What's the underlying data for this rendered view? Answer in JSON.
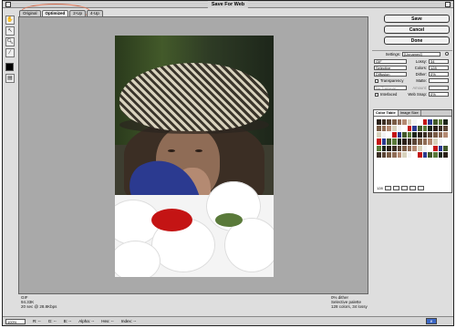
{
  "window": {
    "title": "Save For Web"
  },
  "tabs": [
    {
      "label": "Original",
      "active": false
    },
    {
      "label": "Optimized",
      "active": true
    },
    {
      "label": "2-Up",
      "active": false
    },
    {
      "label": "4-Up",
      "active": false
    }
  ],
  "tools": [
    "hand-tool",
    "slice-select-tool",
    "zoom-tool",
    "eyedropper-tool"
  ],
  "annotation_color": "#e07858",
  "image_info": {
    "left": [
      "GIF",
      "94.33K",
      "20 sec @ 28.8Kbps"
    ],
    "right": [
      "0% dither",
      "Selective palette",
      "128 colors, 34 lossy"
    ]
  },
  "buttons": {
    "save": "Save",
    "cancel": "Cancel",
    "done": "Done"
  },
  "settings": {
    "label": "Settings:",
    "preset": "[Unnamed]",
    "format": "GIF",
    "lossy_label": "Lossy:",
    "lossy_value": "34",
    "palette": "Selective",
    "colors_label": "Colors:",
    "colors_value": "128",
    "dither_algo": "Diffusion",
    "dither_label": "Dither:",
    "dither_value": "0%",
    "transparency_label": "Transparency",
    "matte_label": "Matte:",
    "no_transparency": "No Transpar...",
    "amount_label": "Amount:",
    "interlaced_label": "Interlaced",
    "websnap_label": "Web Snap:",
    "websnap_value": "0%"
  },
  "color_table": {
    "tabs": [
      "Color Table",
      "Image Size"
    ],
    "count": "128"
  },
  "bottom_bar": {
    "zoom": "100%",
    "r": "R: --",
    "g": "G: --",
    "b": "B: --",
    "alpha": "Alpha: --",
    "hex": "Hex: --",
    "index": "Index: --"
  }
}
